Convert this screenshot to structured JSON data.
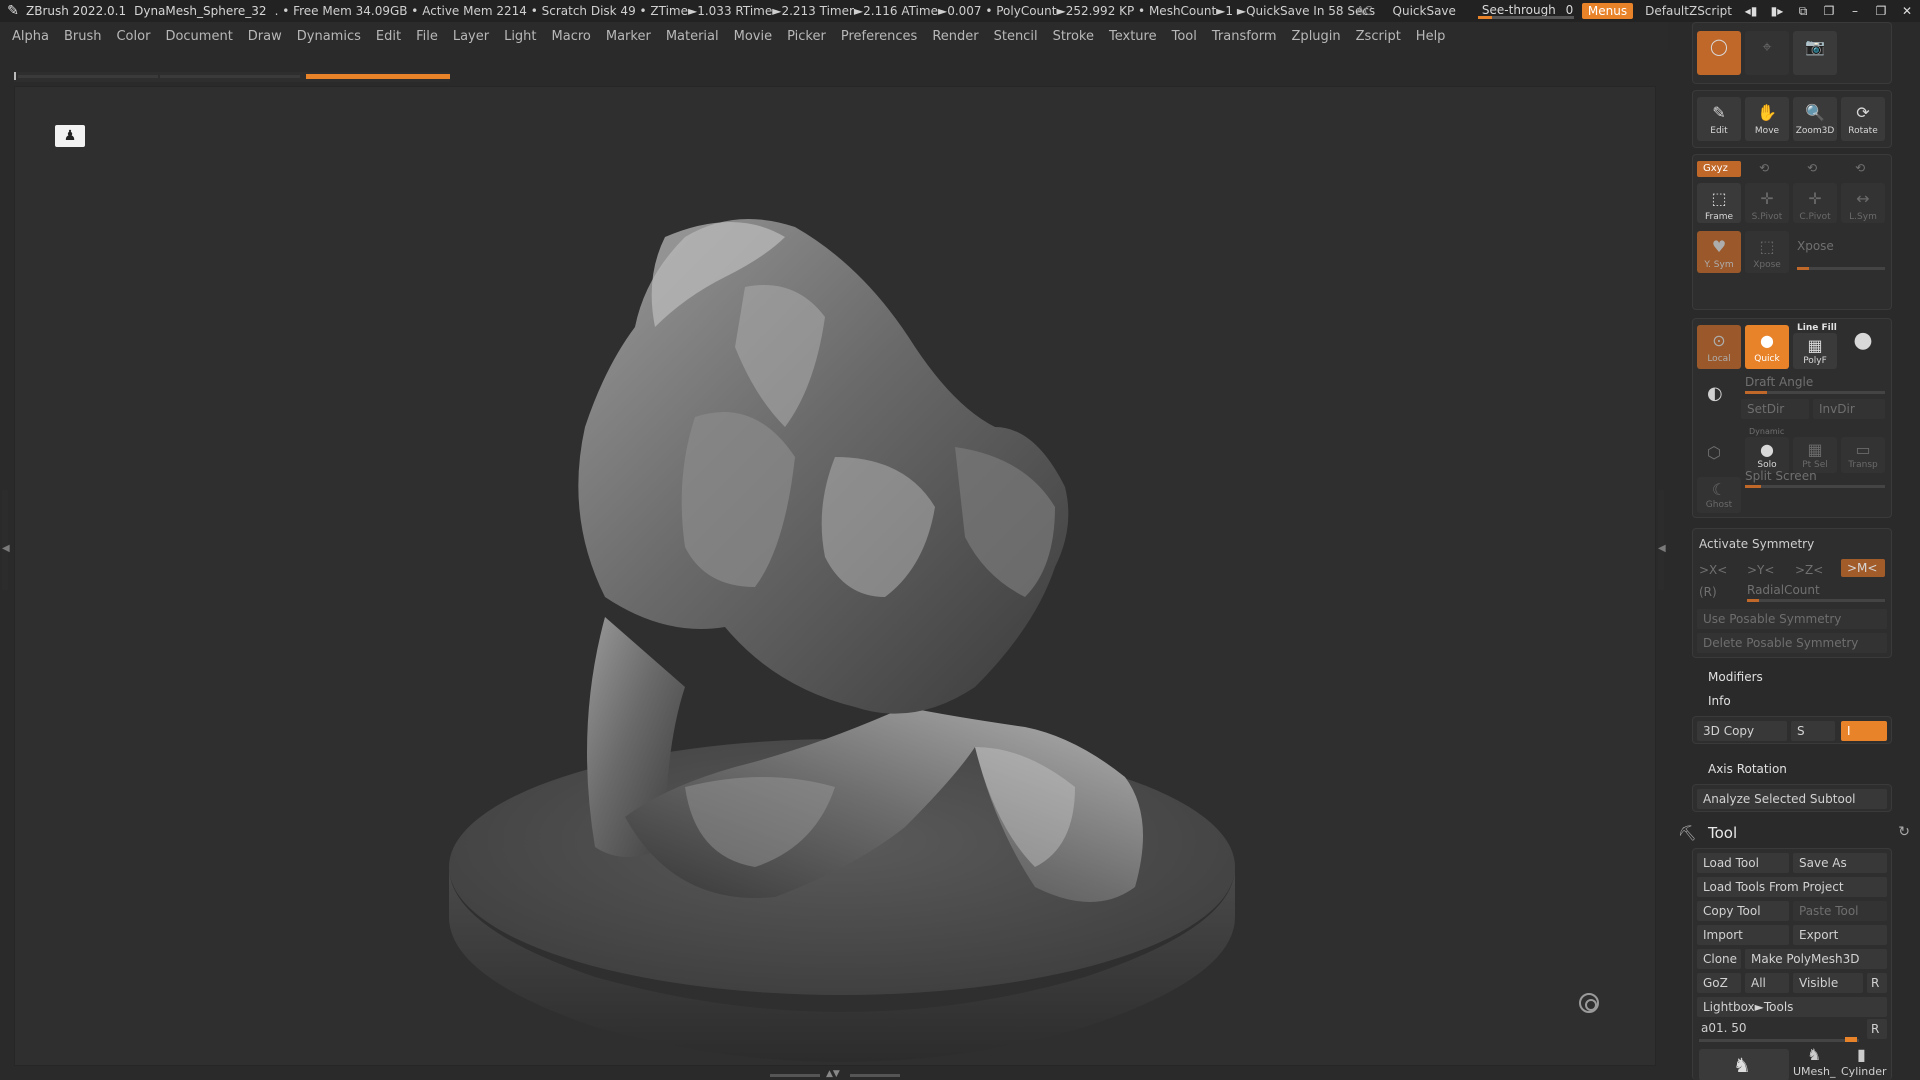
{
  "titlebar": {
    "app": "ZBrush 2022.0.1",
    "doc": "DynaMesh_Sphere_32",
    "status": ". • Free Mem 34.09GB • Active Mem 2214 • Scratch Disk 49 • ZTime►1.033 RTime►2.213 Timer►2.116 ATime►0.007 • PolyCount►252.992 KP • MeshCount►1 ►QuickSave In 58 Secs",
    "ac": "AC",
    "quicksave": "QuickSave",
    "seethrough": "See-through",
    "seethrough_value": "0",
    "seethrough_fraction": 0.0,
    "menus": "Menus",
    "script": "DefaultZScript"
  },
  "menubar": {
    "items": [
      "Alpha",
      "Brush",
      "Color",
      "Document",
      "Draw",
      "Dynamics",
      "Edit",
      "File",
      "Layer",
      "Light",
      "Macro",
      "Marker",
      "Material",
      "Movie",
      "Picker",
      "Preferences",
      "Render",
      "Stencil",
      "Stroke",
      "Texture",
      "Tool",
      "Transform",
      "Zplugin",
      "Zscript",
      "Help"
    ]
  },
  "panel": {
    "nav": {
      "edit": "Edit",
      "move": "Move",
      "zoom3d": "Zoom3D",
      "rotate": "Rotate"
    },
    "xyz": {
      "xyz": "Gxyz",
      "frame": "Frame",
      "spivot": "S.Pivot",
      "cpivot": "C.Pivot",
      "lsym": "L.Sym",
      "ysym": "Y. Sym",
      "xpose": "Xpose",
      "xpose_label": "Xpose"
    },
    "polyf": {
      "local": "Local",
      "quick": "Quick",
      "linefill": "Line Fill",
      "polyf": "PolyF",
      "draft": "Draft Angle",
      "setdir": "SetDir",
      "invdir": "InvDir",
      "dynamic": "Dynamic",
      "solo": "Solo",
      "ptsel": "Pt Sel",
      "transp": "Transp",
      "ghost": "Ghost",
      "split": "Split Screen"
    },
    "symmetry": {
      "activate": "Activate Symmetry",
      "x": ">X<",
      "y": ">Y<",
      "z": ">Z<",
      "m": ">M<",
      "r": "(R)",
      "radial": "RadialCount",
      "use_posable": "Use Posable Symmetry",
      "delete_posable": "Delete Posable Symmetry"
    },
    "modifiers": "Modifiers",
    "info": "Info",
    "copy3d": "3D Copy",
    "copy3d_s": "S",
    "copy3d_i": "I",
    "axis_rotation": "Axis Rotation",
    "analyze": "Analyze Selected Subtool"
  },
  "tool": {
    "title": "Tool",
    "load": "Load Tool",
    "saveas": "Save As",
    "load_project": "Load Tools From Project",
    "copy": "Copy Tool",
    "paste": "Paste Tool",
    "import": "Import",
    "export": "Export",
    "clone": "Clone",
    "make_polymesh": "Make PolyMesh3D",
    "goz": "GoZ",
    "all": "All",
    "visible": "Visible",
    "r": "R",
    "lightbox": "Lightbox►Tools",
    "current": "a01. 50",
    "current_r": "R",
    "thumbs": [
      "UMesh_",
      "Cylinder"
    ]
  }
}
